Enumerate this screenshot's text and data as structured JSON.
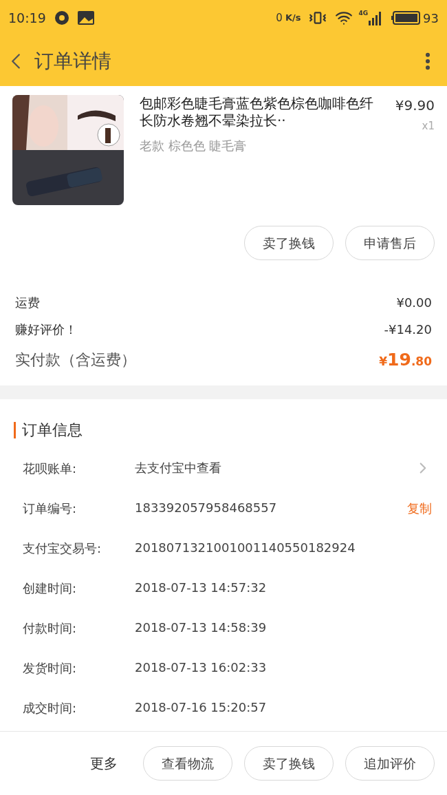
{
  "status_bar": {
    "time": "10:19",
    "net_speed": "0",
    "net_unit": "K/s",
    "network": "4G",
    "battery": "93"
  },
  "header": {
    "title": "订单详情"
  },
  "product": {
    "kind": "picture",
    "title": "包邮彩色睫毛膏蓝色紫色棕色咖啡色纤长防水卷翘不晕染拉长··",
    "price": "¥9.90",
    "quantity": "x1",
    "variant": "老款 棕色色 睫毛膏",
    "buttons": [
      "卖了换钱",
      "申请售后"
    ]
  },
  "summary": [
    {
      "label": "运费",
      "value": "¥0.00"
    },
    {
      "label": "赚好评价！",
      "value": "-¥14.20"
    }
  ],
  "total": {
    "label": "实付款（含运费）",
    "currency": "¥",
    "integer": "19",
    "decimal": ".80"
  },
  "order_info": {
    "title": "订单信息",
    "rows": [
      {
        "label": "花呗账单:",
        "value": "去支付宝中查看",
        "kind": "link"
      },
      {
        "label": "订单编号:",
        "value": "183392057958468557",
        "kind": "copy",
        "action": "复制"
      },
      {
        "label": "支付宝交易号:",
        "value": "2018071321001001140550182924",
        "kind": "plain"
      },
      {
        "label": "创建时间:",
        "value": "2018-07-13 14:57:32",
        "kind": "plain"
      },
      {
        "label": "付款时间:",
        "value": "2018-07-13 14:58:39",
        "kind": "plain"
      },
      {
        "label": "发货时间:",
        "value": "2018-07-13 16:02:33",
        "kind": "plain"
      },
      {
        "label": "成交时间:",
        "value": "2018-07-16 15:20:57",
        "kind": "plain"
      }
    ]
  },
  "bottom_bar": {
    "more": "更多",
    "buttons": [
      "查看物流",
      "卖了换钱",
      "追加评价"
    ]
  }
}
